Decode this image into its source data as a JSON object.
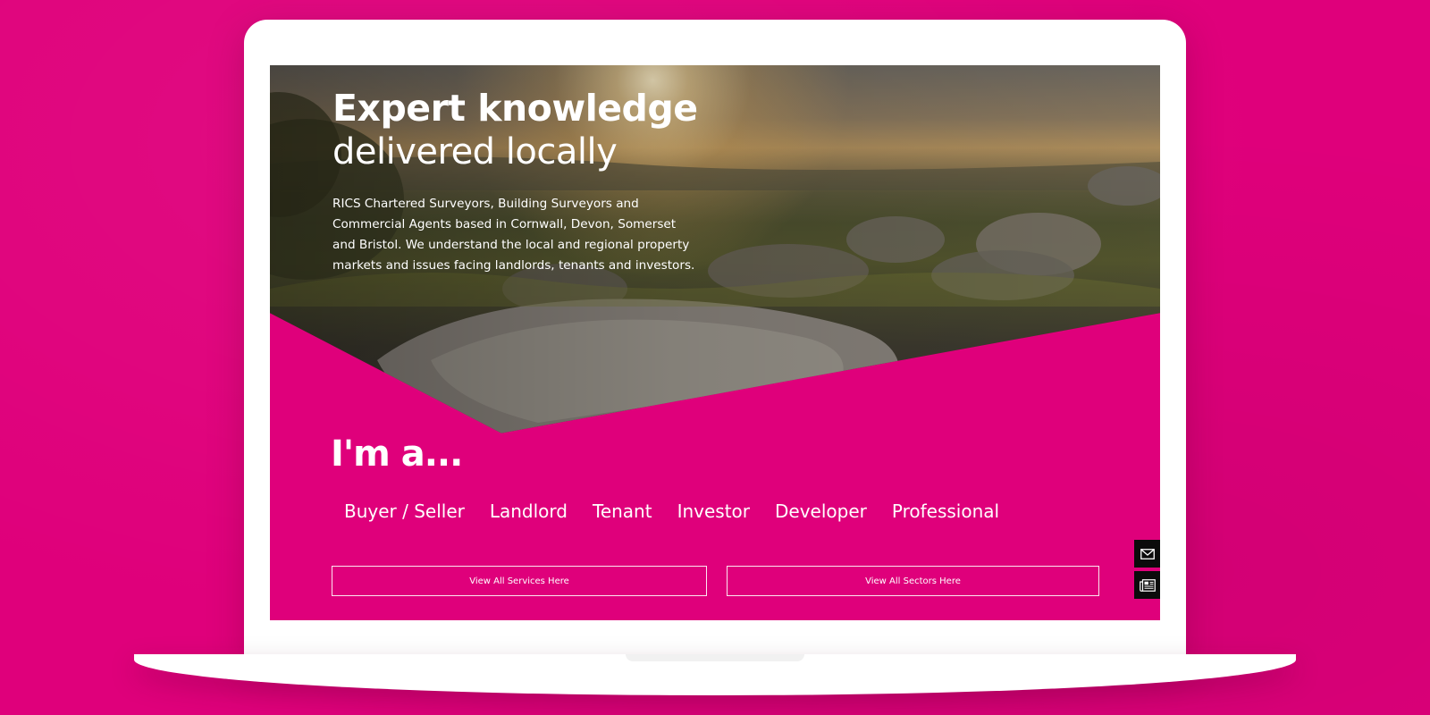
{
  "colors": {
    "brand": "#df007b",
    "text": "#ffffff",
    "side_buttons": "#0b0b0b"
  },
  "hero": {
    "title": "Expert knowledge",
    "subtitle": "delivered locally",
    "body": "RICS Chartered Surveyors, Building Surveyors and Commercial Agents based in Cornwall, Devon, Somerset and Bristol. We understand the local and regional property markets and issues facing landlords, tenants and investors."
  },
  "audience": {
    "heading": "I'm a...",
    "roles": [
      "Buyer / Seller",
      "Landlord",
      "Tenant",
      "Investor",
      "Developer",
      "Professional"
    ]
  },
  "buttons": {
    "services": "View All Services Here",
    "sectors": "View All Sectors Here"
  },
  "side_actions": {
    "mail_icon": "envelope-icon",
    "news_icon": "newspaper-icon"
  }
}
